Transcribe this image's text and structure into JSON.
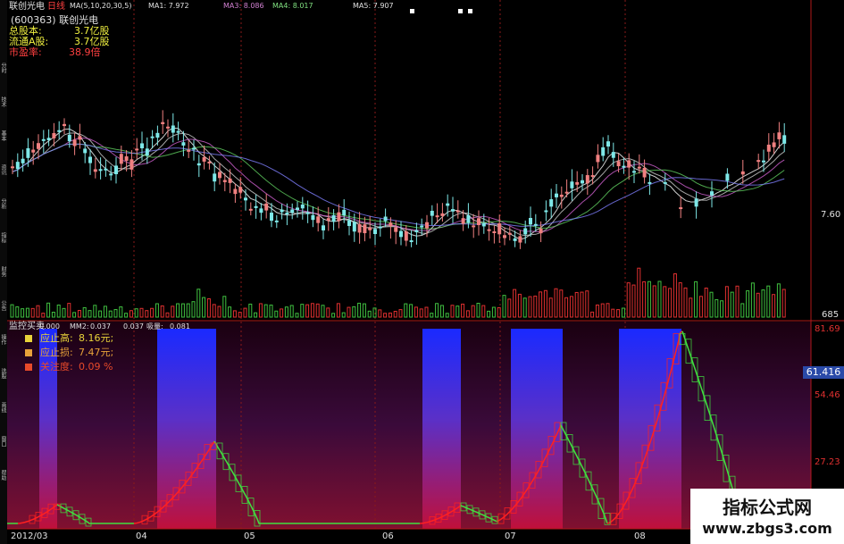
{
  "header": {
    "code": "联创光电",
    "period": "日线",
    "ma_label": "MA(5,10,20,30,5)",
    "ma1": "MA1: 7.972",
    "ma3": "MA3: 8.086",
    "ma4": "MA4: 8.017",
    "ma5": "MA5: 7.907"
  },
  "info": {
    "stock_line": "(600363) 联创光电",
    "total_shares_label": "总股本:",
    "total_shares_value": "3.7亿股",
    "float_shares_label": "流通A股:",
    "float_shares_value": "3.7亿股",
    "pe_label": "市盈率:",
    "pe_value": "38.9倍"
  },
  "right_axis": {
    "price_tick": "7.60",
    "volume_tick": "685",
    "ind_ticks": [
      "81.69",
      "54.46",
      "27.23"
    ],
    "current_value": "61.416"
  },
  "indicator": {
    "title": "监控买卖",
    "v1": "0.000",
    "v2_label": "MM2:",
    "v2": "0.037",
    "v3": "0.037",
    "v4_label": "吸量:",
    "v4": "0.081",
    "legend": [
      {
        "label": "应止高:",
        "value": "8.16元;",
        "color": "#e8d23a"
      },
      {
        "label": "应止损:",
        "value": "7.47元;",
        "color": "#e8a23a"
      },
      {
        "label": "关注度:",
        "value": "0.09 %",
        "color": "#e84a2a"
      }
    ]
  },
  "date_axis": [
    "2012/03",
    "04",
    "05",
    "06",
    "07",
    "08"
  ],
  "sidebar_tabs": [
    "分时",
    "技术",
    "基本",
    "资讯",
    "分析",
    "指标",
    "财务",
    "公告",
    "操作",
    "选股",
    "画线",
    "窗口",
    "帮助"
  ],
  "watermark": {
    "line1": "指标公式网",
    "line2": "www.zbgs3.com"
  },
  "colors": {
    "up": "#f08080",
    "down": "#7ee8e8",
    "vol_up": "#e03030",
    "vol_down": "#40c040",
    "band": "#2a20ff",
    "curve_up": "#ff2020",
    "curve_down": "#40e040",
    "grid": "#8a1a1a"
  }
}
